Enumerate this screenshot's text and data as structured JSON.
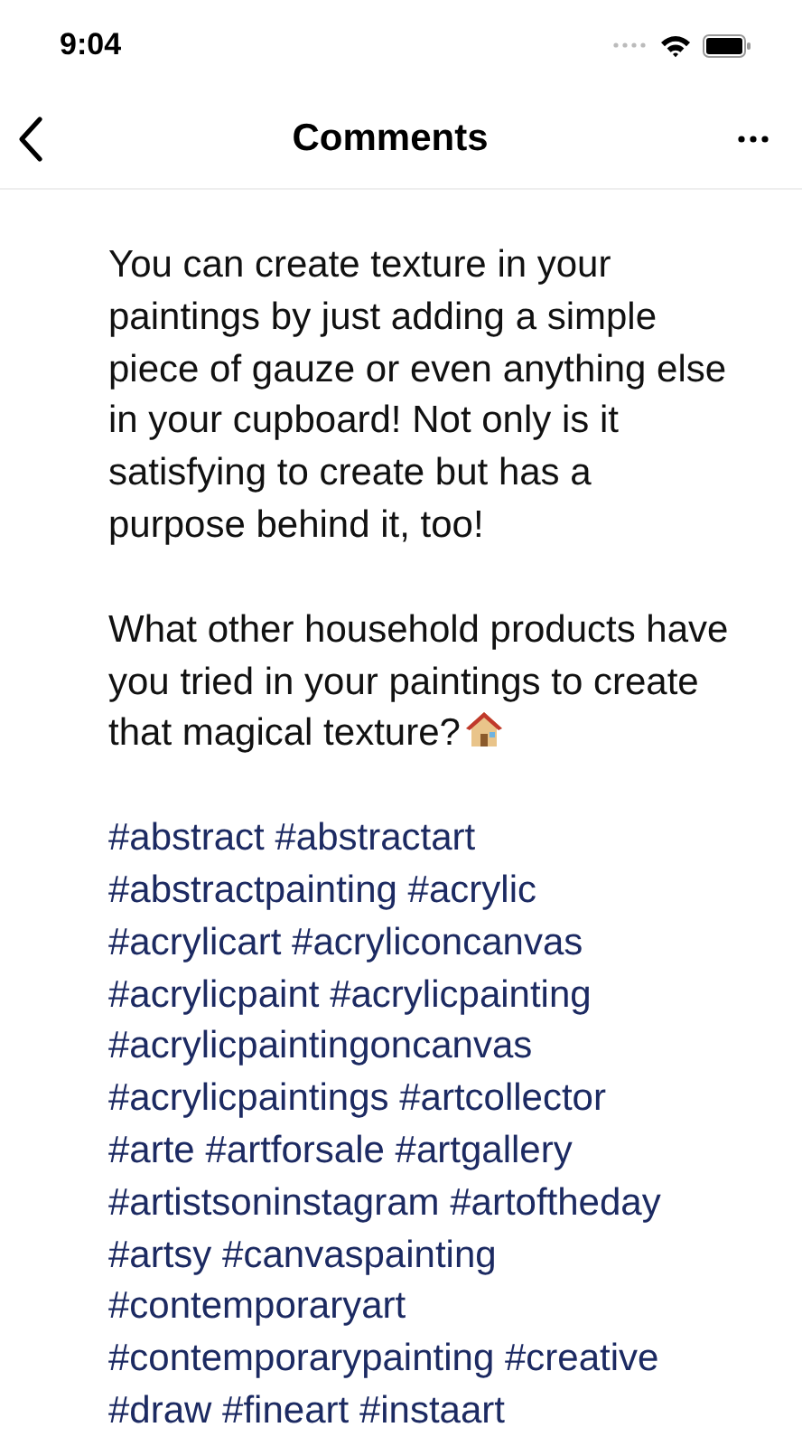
{
  "status_bar": {
    "time": "9:04"
  },
  "header": {
    "title": "Comments"
  },
  "comment": {
    "paragraphs": [
      "You can create texture in your paintings by just adding a simple piece of gauze or even anything else in your cupboard! Not only is it satisfying to create but has a purpose behind it, too!",
      "What other household products have you tried in your paintings to create that magical texture?"
    ],
    "hashtag_lines": [
      [
        "#abstract",
        "#abstractart"
      ],
      [
        "#abstractpainting",
        "#acrylic"
      ],
      [
        "#acrylicart",
        "#acryliconcanvas"
      ],
      [
        "#acrylicpaint",
        "#acrylicpainting"
      ],
      [
        "#acrylicpaintingoncanvas"
      ],
      [
        "#acrylicpaintings",
        "#artcollector"
      ],
      [
        "#arte",
        "#artforsale",
        "#artgallery"
      ],
      [
        "#artistsoninstagram",
        "#artoftheday"
      ],
      [
        "#artsy",
        "#canvaspainting"
      ],
      [
        "#contemporaryart"
      ],
      [
        "#contemporarypainting",
        "#creative"
      ],
      [
        "#draw",
        "#fineart",
        "#instaart"
      ]
    ]
  }
}
